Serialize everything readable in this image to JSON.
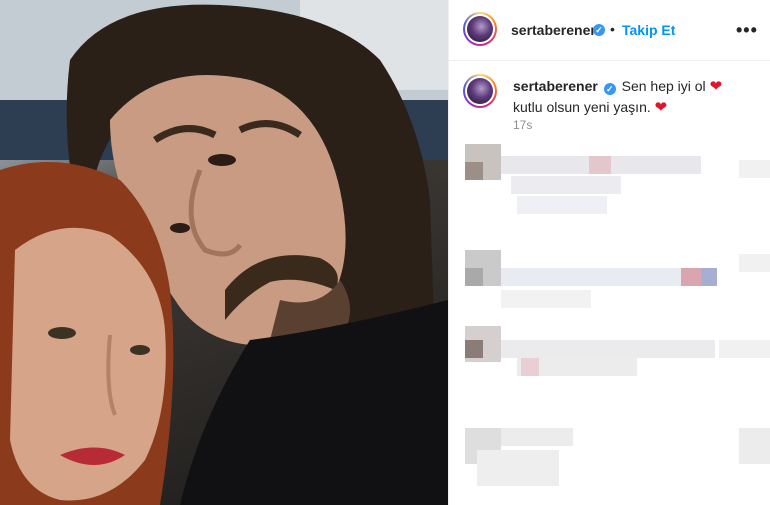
{
  "post": {
    "username": "sertaberener",
    "verified_icon": "verified-badge-icon",
    "separator": "•",
    "follow_label": "Takip Et",
    "more_icon": "more-options-icon",
    "more_glyph": "•••"
  },
  "caption": {
    "username": "sertaberener",
    "text_line1": "Sen hep iyi ol",
    "text_line2": "kutlu olsun yeni yaşın.",
    "heart_glyph": "❤",
    "time": "17s"
  },
  "colors": {
    "link_blue": "#0095f6",
    "verified_blue": "#3897f0",
    "heart_red": "#e0152c",
    "muted_gray": "#8e8e8e"
  }
}
